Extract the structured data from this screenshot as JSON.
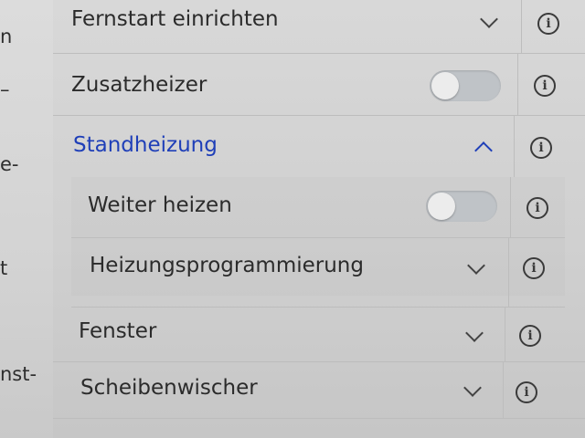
{
  "left_fragments": [
    "n",
    "–",
    "e-",
    "t",
    "nst-"
  ],
  "rows": {
    "fernstart": {
      "label": "Fernstart einrichten"
    },
    "zusatzheizer": {
      "label": "Zusatzheizer",
      "toggle_on": false
    },
    "standheizung": {
      "label": "Standheizung",
      "expanded": true
    },
    "weiter_heizen": {
      "label": "Weiter heizen",
      "toggle_on": false
    },
    "heizungsprogrammierung": {
      "label": "Heizungsprogrammierung"
    },
    "fenster": {
      "label": "Fenster"
    },
    "scheibenwischer": {
      "label": "Scheibenwischer"
    }
  },
  "icons": {
    "info": "i",
    "chevron": "chevron-icon"
  },
  "colors": {
    "active": "#1f3fb8",
    "text": "#2b2b2b",
    "toggle_off": "#bfc3c7"
  }
}
